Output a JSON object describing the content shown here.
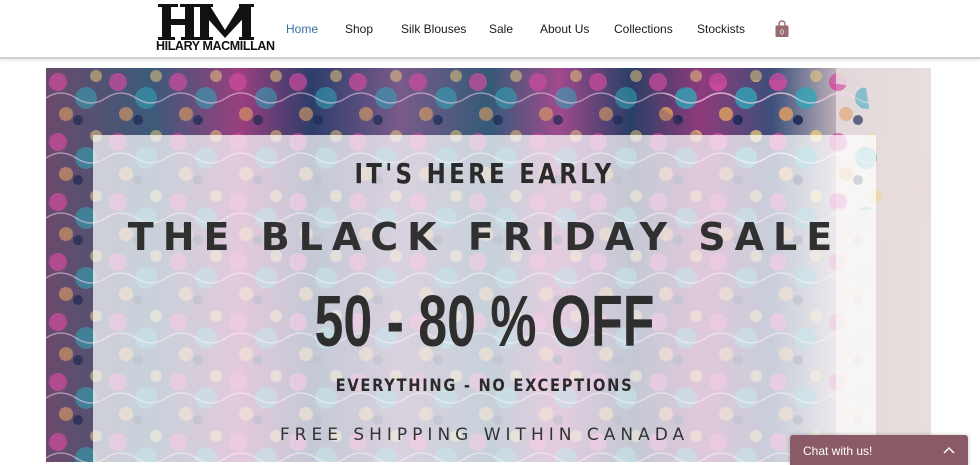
{
  "brand": {
    "logo_text": "HILARY MACMILLAN",
    "logo_icon": "hm-monogram-icon"
  },
  "nav": {
    "items": [
      {
        "label": "Home",
        "active": true
      },
      {
        "label": "Shop"
      },
      {
        "label": "Silk Blouses"
      },
      {
        "label": "Sale"
      },
      {
        "label": "About Us"
      },
      {
        "label": "Collections"
      },
      {
        "label": "Stockists"
      }
    ],
    "cart": {
      "icon": "shopping-bag-icon",
      "count": "0"
    }
  },
  "hero": {
    "eyebrow": "IT'S  HERE  EARLY",
    "headline": "THE BLACK FRIDAY SALE",
    "discount": "50 - 80 % OFF",
    "subline": "EVERYTHING - NO EXCEPTIONS",
    "shipping": "FREE SHIPPING WITHIN CANADA"
  },
  "chat": {
    "label": "Chat with us!",
    "icon": "chevron-up-icon",
    "color": "#8a5a66"
  },
  "colors": {
    "nav_active": "#3a6fa5",
    "nav_text": "#1a1a1a",
    "promo_text": "#2b2b2b"
  }
}
